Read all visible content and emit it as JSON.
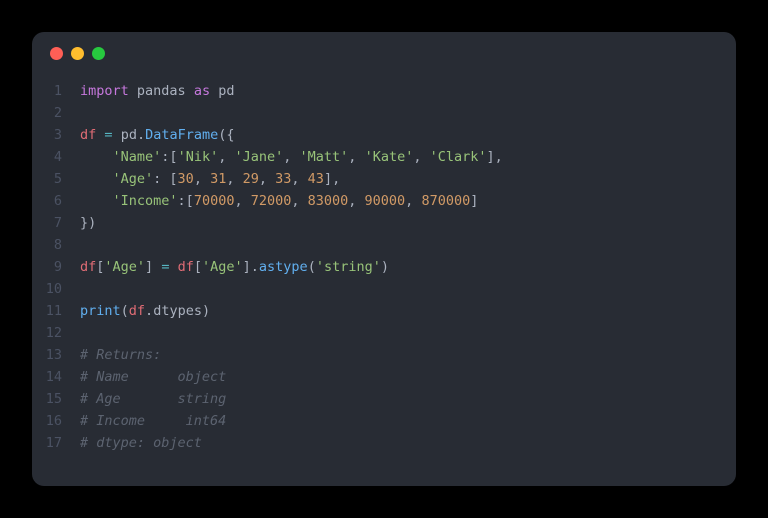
{
  "code": {
    "lines": [
      {
        "n": "1",
        "tokens": [
          {
            "cls": "kw-import",
            "t": "import"
          },
          {
            "cls": "",
            "t": " "
          },
          {
            "cls": "module",
            "t": "pandas"
          },
          {
            "cls": "",
            "t": " "
          },
          {
            "cls": "kw-as",
            "t": "as"
          },
          {
            "cls": "",
            "t": " "
          },
          {
            "cls": "module",
            "t": "pd"
          }
        ]
      },
      {
        "n": "2",
        "tokens": []
      },
      {
        "n": "3",
        "tokens": [
          {
            "cls": "var",
            "t": "df"
          },
          {
            "cls": "",
            "t": " "
          },
          {
            "cls": "op",
            "t": "="
          },
          {
            "cls": "",
            "t": " "
          },
          {
            "cls": "attr",
            "t": "pd"
          },
          {
            "cls": "punct",
            "t": "."
          },
          {
            "cls": "func",
            "t": "DataFrame"
          },
          {
            "cls": "punct",
            "t": "({"
          }
        ]
      },
      {
        "n": "4",
        "tokens": [
          {
            "cls": "",
            "t": "    "
          },
          {
            "cls": "string",
            "t": "'Name'"
          },
          {
            "cls": "punct",
            "t": ":["
          },
          {
            "cls": "string",
            "t": "'Nik'"
          },
          {
            "cls": "punct",
            "t": ", "
          },
          {
            "cls": "string",
            "t": "'Jane'"
          },
          {
            "cls": "punct",
            "t": ", "
          },
          {
            "cls": "string",
            "t": "'Matt'"
          },
          {
            "cls": "punct",
            "t": ", "
          },
          {
            "cls": "string",
            "t": "'Kate'"
          },
          {
            "cls": "punct",
            "t": ", "
          },
          {
            "cls": "string",
            "t": "'Clark'"
          },
          {
            "cls": "punct",
            "t": "],"
          }
        ]
      },
      {
        "n": "5",
        "tokens": [
          {
            "cls": "",
            "t": "    "
          },
          {
            "cls": "string",
            "t": "'Age'"
          },
          {
            "cls": "punct",
            "t": ": ["
          },
          {
            "cls": "number",
            "t": "30"
          },
          {
            "cls": "punct",
            "t": ", "
          },
          {
            "cls": "number",
            "t": "31"
          },
          {
            "cls": "punct",
            "t": ", "
          },
          {
            "cls": "number",
            "t": "29"
          },
          {
            "cls": "punct",
            "t": ", "
          },
          {
            "cls": "number",
            "t": "33"
          },
          {
            "cls": "punct",
            "t": ", "
          },
          {
            "cls": "number",
            "t": "43"
          },
          {
            "cls": "punct",
            "t": "],"
          }
        ]
      },
      {
        "n": "6",
        "tokens": [
          {
            "cls": "",
            "t": "    "
          },
          {
            "cls": "string",
            "t": "'Income'"
          },
          {
            "cls": "punct",
            "t": ":["
          },
          {
            "cls": "number",
            "t": "70000"
          },
          {
            "cls": "punct",
            "t": ", "
          },
          {
            "cls": "number",
            "t": "72000"
          },
          {
            "cls": "punct",
            "t": ", "
          },
          {
            "cls": "number",
            "t": "83000"
          },
          {
            "cls": "punct",
            "t": ", "
          },
          {
            "cls": "number",
            "t": "90000"
          },
          {
            "cls": "punct",
            "t": ", "
          },
          {
            "cls": "number",
            "t": "870000"
          },
          {
            "cls": "punct",
            "t": "]"
          }
        ]
      },
      {
        "n": "7",
        "tokens": [
          {
            "cls": "punct",
            "t": "})"
          }
        ]
      },
      {
        "n": "8",
        "tokens": []
      },
      {
        "n": "9",
        "tokens": [
          {
            "cls": "var",
            "t": "df"
          },
          {
            "cls": "punct",
            "t": "["
          },
          {
            "cls": "string",
            "t": "'Age'"
          },
          {
            "cls": "punct",
            "t": "] "
          },
          {
            "cls": "op",
            "t": "="
          },
          {
            "cls": "",
            "t": " "
          },
          {
            "cls": "var",
            "t": "df"
          },
          {
            "cls": "punct",
            "t": "["
          },
          {
            "cls": "string",
            "t": "'Age'"
          },
          {
            "cls": "punct",
            "t": "]."
          },
          {
            "cls": "method",
            "t": "astype"
          },
          {
            "cls": "punct",
            "t": "("
          },
          {
            "cls": "string",
            "t": "'string'"
          },
          {
            "cls": "punct",
            "t": ")"
          }
        ]
      },
      {
        "n": "10",
        "tokens": []
      },
      {
        "n": "11",
        "tokens": [
          {
            "cls": "func",
            "t": "print"
          },
          {
            "cls": "punct",
            "t": "("
          },
          {
            "cls": "var",
            "t": "df"
          },
          {
            "cls": "punct",
            "t": "."
          },
          {
            "cls": "attr",
            "t": "dtypes"
          },
          {
            "cls": "punct",
            "t": ")"
          }
        ]
      },
      {
        "n": "12",
        "tokens": []
      },
      {
        "n": "13",
        "tokens": [
          {
            "cls": "comment",
            "t": "# Returns:"
          }
        ]
      },
      {
        "n": "14",
        "tokens": [
          {
            "cls": "comment",
            "t": "# Name      object"
          }
        ]
      },
      {
        "n": "15",
        "tokens": [
          {
            "cls": "comment",
            "t": "# Age       string"
          }
        ]
      },
      {
        "n": "16",
        "tokens": [
          {
            "cls": "comment",
            "t": "# Income     int64"
          }
        ]
      },
      {
        "n": "17",
        "tokens": [
          {
            "cls": "comment",
            "t": "# dtype: object"
          }
        ]
      }
    ]
  }
}
